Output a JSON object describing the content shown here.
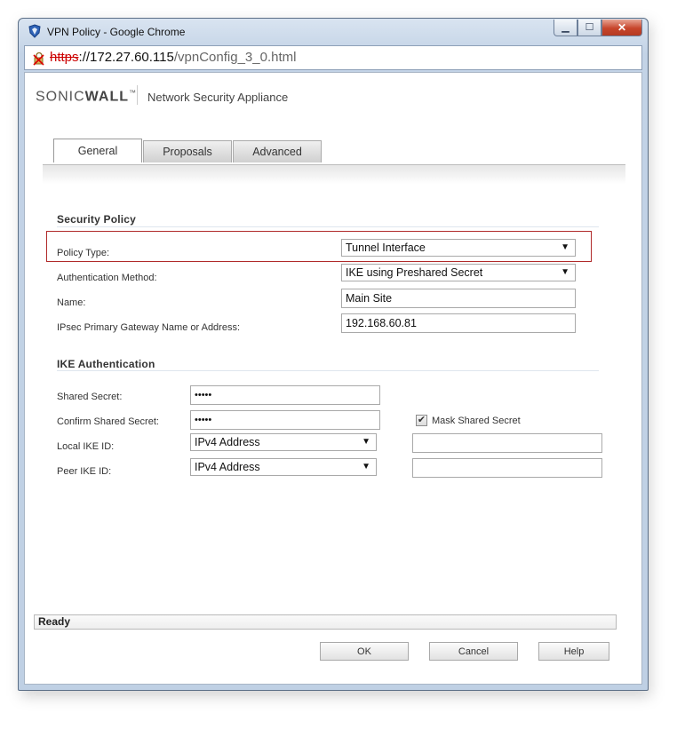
{
  "window": {
    "title": "VPN Policy - Google Chrome",
    "url_scheme": "https",
    "url_host": "://172.27.60.115",
    "url_path": "/vpnConfig_3_0.html"
  },
  "header": {
    "logo_sonic": "SONIC",
    "logo_wall": "WALL",
    "logo_mark": "™",
    "product": "Network Security Appliance"
  },
  "tabs": [
    {
      "label": "General",
      "active": true
    },
    {
      "label": "Proposals",
      "active": false
    },
    {
      "label": "Advanced",
      "active": false
    }
  ],
  "security_policy": {
    "title": "Security Policy",
    "policy_type_label": "Policy Type:",
    "policy_type_value": "Tunnel Interface",
    "auth_method_label": "Authentication Method:",
    "auth_method_value": "IKE using Preshared Secret",
    "name_label": "Name:",
    "name_value": "Main Site",
    "gateway_label": "IPsec Primary Gateway Name or Address:",
    "gateway_value": "192.168.60.81"
  },
  "ike_auth": {
    "title": "IKE Authentication",
    "shared_secret_label": "Shared Secret:",
    "shared_secret_value": "•••••",
    "confirm_secret_label": "Confirm Shared Secret:",
    "confirm_secret_value": "•••••",
    "mask_label": "Mask Shared Secret",
    "mask_checked": true,
    "local_ike_label": "Local IKE ID:",
    "local_ike_type": "IPv4 Address",
    "local_ike_value": "",
    "peer_ike_label": "Peer IKE ID:",
    "peer_ike_type": "IPv4 Address",
    "peer_ike_value": ""
  },
  "status": "Ready",
  "buttons": {
    "ok": "OK",
    "cancel": "Cancel",
    "help": "Help"
  },
  "colors": {
    "highlight": "#b02a2a",
    "titlebar": "#c3d3e6",
    "close": "#c7452b"
  }
}
